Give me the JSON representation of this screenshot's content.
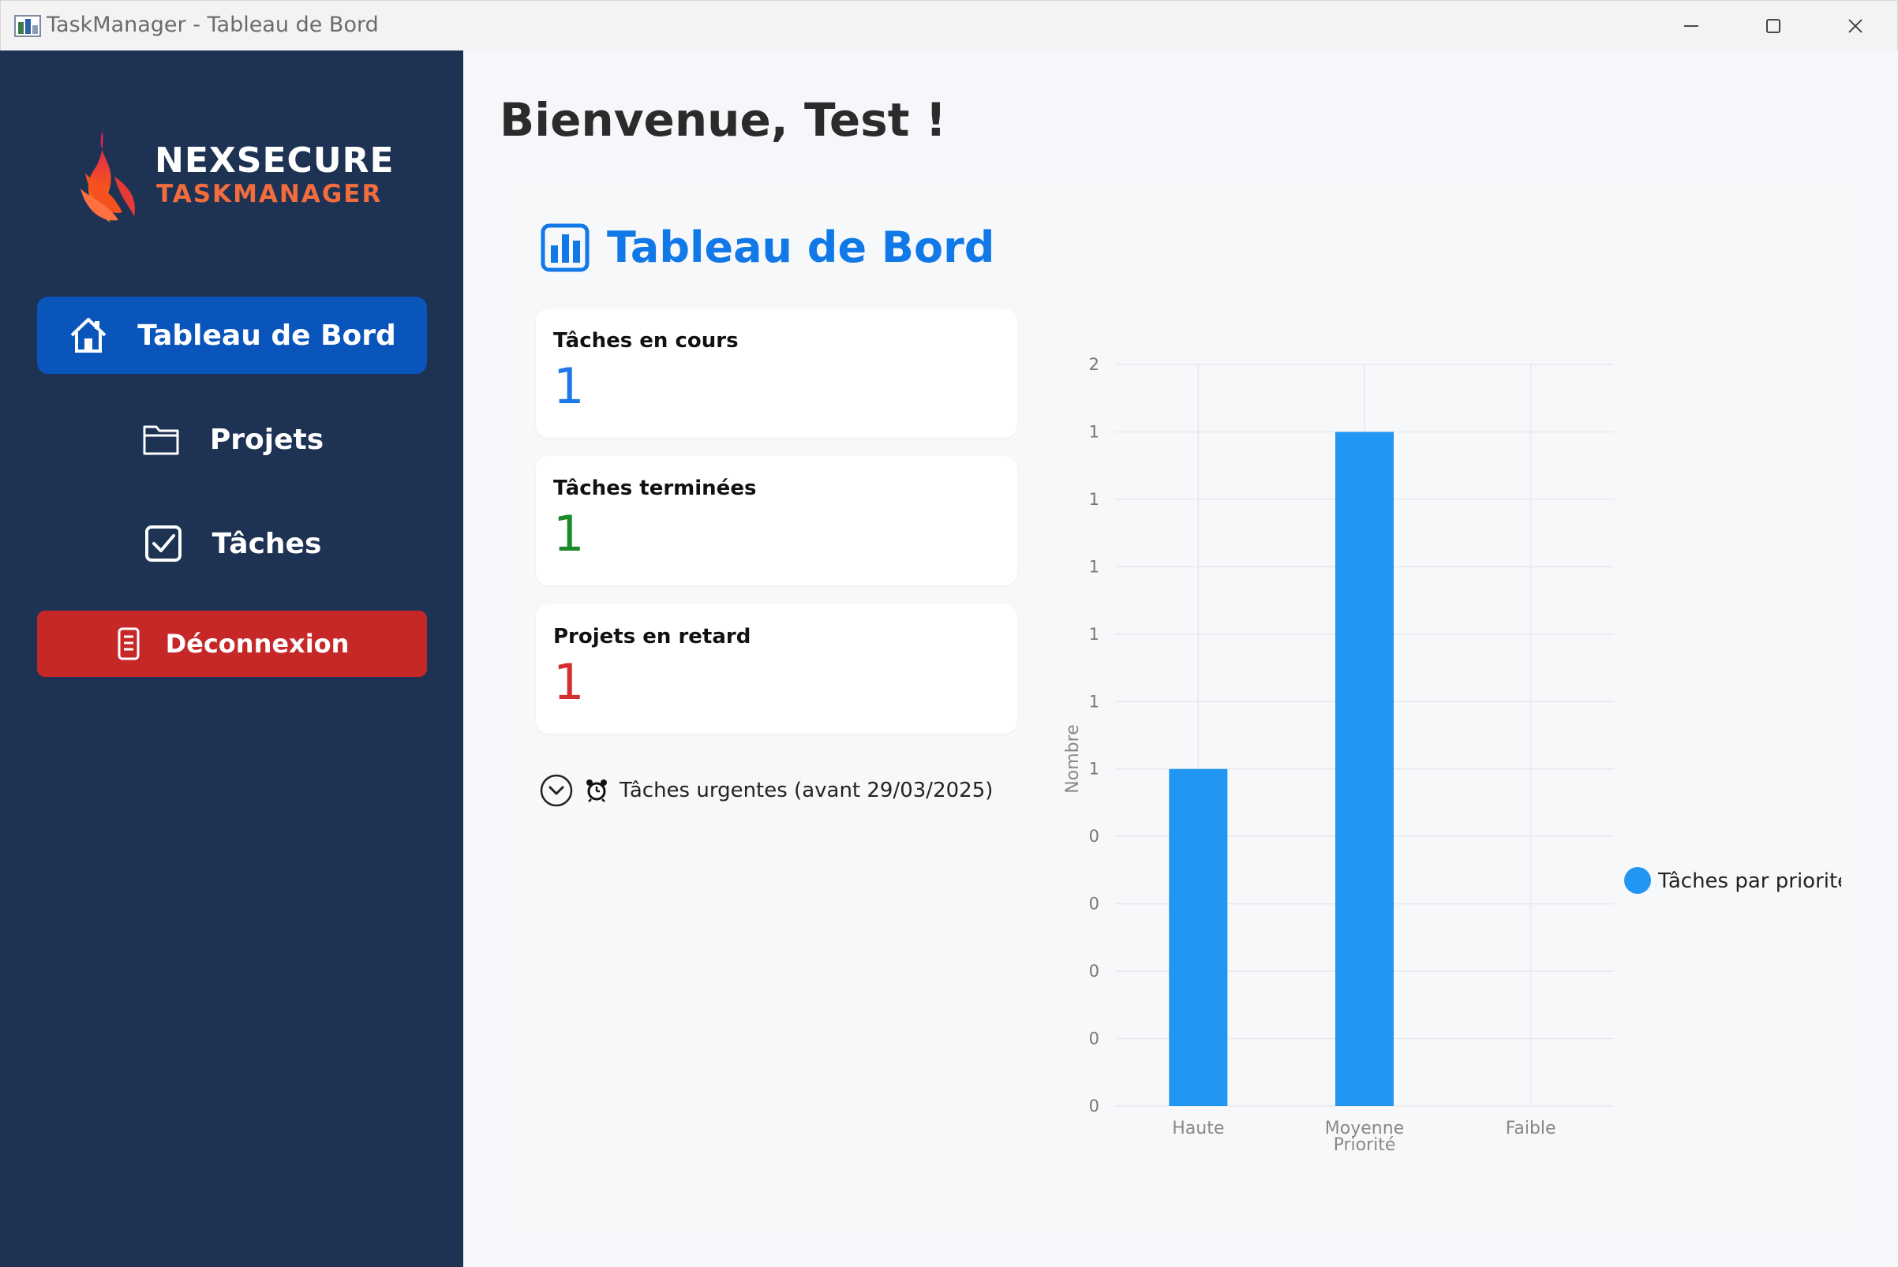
{
  "window": {
    "title": "TaskManager - Tableau de Bord"
  },
  "sidebar": {
    "logo": {
      "line1": "NEXSECURE",
      "line2": "TASKMANAGER"
    },
    "items": [
      {
        "label": "Tableau de Bord",
        "icon": "home-icon",
        "active": true
      },
      {
        "label": "Projets",
        "icon": "folder-icon",
        "active": false
      },
      {
        "label": "Tâches",
        "icon": "checkbox-icon",
        "active": false
      }
    ],
    "logout_label": "Déconnexion"
  },
  "main": {
    "welcome": "Bienvenue, Test !",
    "panel_title": "Tableau de Bord",
    "cards": [
      {
        "label": "Tâches en cours",
        "value": "1"
      },
      {
        "label": "Tâches terminées",
        "value": "1"
      },
      {
        "label": "Projets en retard",
        "value": "1"
      }
    ],
    "urgent_label": "Tâches urgentes (avant 29/03/2025)"
  },
  "colors": {
    "sidebar_bg": "#1e3254",
    "active_nav": "#0a55bb",
    "logout": "#c62828",
    "accent": "#1178e8",
    "bar": "#2196f3"
  },
  "chart_data": {
    "type": "bar",
    "categories": [
      "Haute",
      "Moyenne",
      "Faible"
    ],
    "series": [
      {
        "name": "Tâches par priorité",
        "values": [
          1,
          2,
          0
        ]
      }
    ],
    "xlabel": "Priorité",
    "ylabel": "Nombre",
    "ylim": [
      0,
      2.2
    ],
    "yticks": [
      {
        "value": 0,
        "label": "0"
      },
      {
        "value": 0.2,
        "label": "0"
      },
      {
        "value": 0.4,
        "label": "0"
      },
      {
        "value": 0.6,
        "label": "0"
      },
      {
        "value": 0.8,
        "label": "0"
      },
      {
        "value": 1.0,
        "label": "1"
      },
      {
        "value": 1.2,
        "label": "1"
      },
      {
        "value": 1.4,
        "label": "1"
      },
      {
        "value": 1.6,
        "label": "1"
      },
      {
        "value": 1.8,
        "label": "1"
      },
      {
        "value": 2.0,
        "label": "1"
      },
      {
        "value": 2.2,
        "label": "2"
      }
    ],
    "grid": true,
    "legend": "right"
  }
}
